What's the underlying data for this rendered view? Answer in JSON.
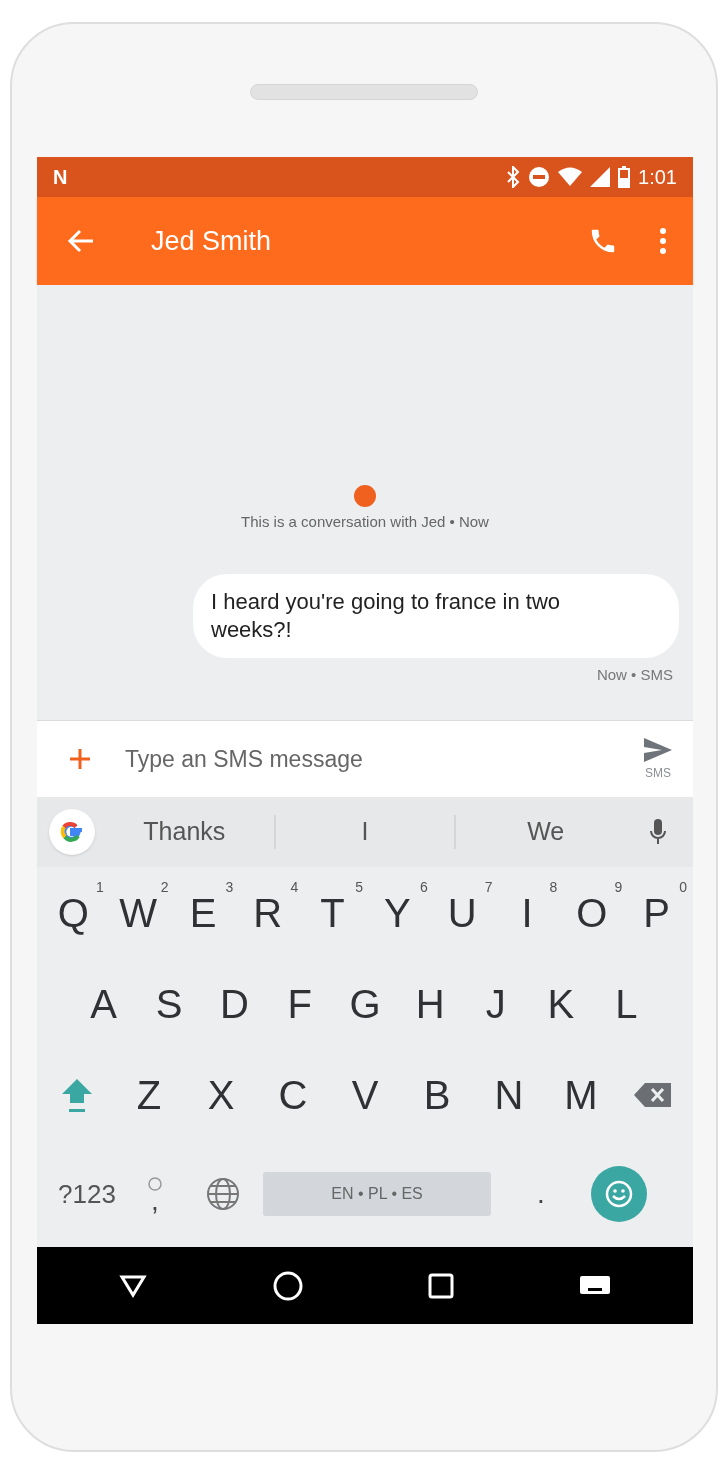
{
  "status_bar": {
    "notification": "N",
    "time": "1:01"
  },
  "app_bar": {
    "title": "Jed Smith"
  },
  "conversation": {
    "intro": "This is a conversation with Jed • Now",
    "messages": [
      {
        "text": "I heard you're going to france in two weeks?!",
        "meta": "Now • SMS"
      }
    ]
  },
  "compose": {
    "placeholder": "Type an SMS message",
    "send_label": "SMS"
  },
  "suggestions": [
    "Thanks",
    "I",
    "We"
  ],
  "keyboard": {
    "rows": [
      [
        {
          "label": "Q",
          "hint": "1"
        },
        {
          "label": "W",
          "hint": "2"
        },
        {
          "label": "E",
          "hint": "3"
        },
        {
          "label": "R",
          "hint": "4"
        },
        {
          "label": "T",
          "hint": "5"
        },
        {
          "label": "Y",
          "hint": "6"
        },
        {
          "label": "U",
          "hint": "7"
        },
        {
          "label": "I",
          "hint": "8"
        },
        {
          "label": "O",
          "hint": "9"
        },
        {
          "label": "P",
          "hint": "0"
        }
      ],
      [
        {
          "label": "A"
        },
        {
          "label": "S"
        },
        {
          "label": "D"
        },
        {
          "label": "F"
        },
        {
          "label": "G"
        },
        {
          "label": "H"
        },
        {
          "label": "J"
        },
        {
          "label": "K"
        },
        {
          "label": "L"
        }
      ],
      [
        {
          "kind": "shift"
        },
        {
          "label": "Z"
        },
        {
          "label": "X"
        },
        {
          "label": "C"
        },
        {
          "label": "V"
        },
        {
          "label": "B"
        },
        {
          "label": "N"
        },
        {
          "label": "M"
        },
        {
          "kind": "backspace"
        }
      ]
    ],
    "bottom": {
      "symbols": "?123",
      "comma": ",",
      "space": "EN • PL • ES",
      "period": "."
    }
  }
}
